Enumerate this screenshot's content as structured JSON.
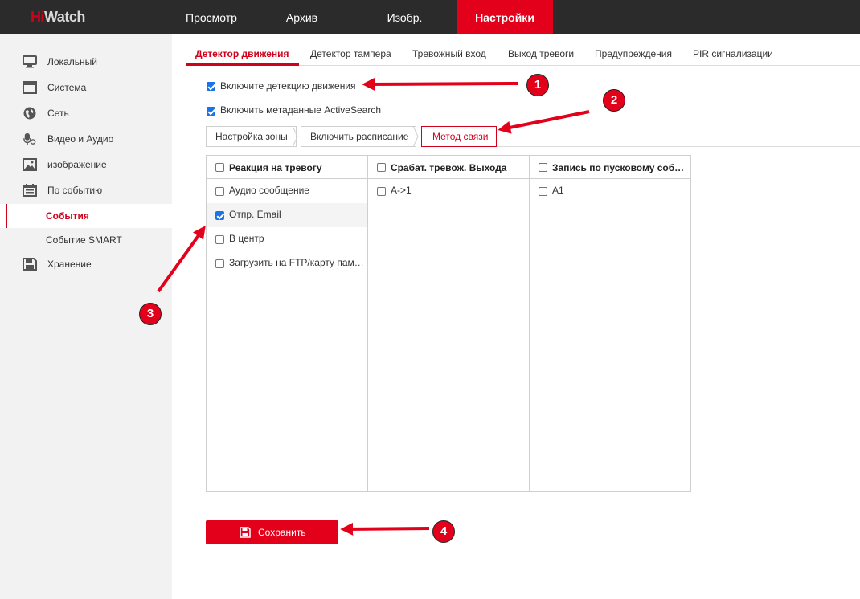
{
  "brand": {
    "hi": "Hi",
    "watch": "Watch"
  },
  "topnav": [
    {
      "label": "Просмотр",
      "active": false
    },
    {
      "label": "Архив",
      "active": false
    },
    {
      "label": "Изобр.",
      "active": false
    },
    {
      "label": "Настройки",
      "active": true
    }
  ],
  "sidebar": {
    "items": [
      {
        "label": "Локальный",
        "icon": "monitor-icon"
      },
      {
        "label": "Система",
        "icon": "window-icon"
      },
      {
        "label": "Сеть",
        "icon": "globe-icon"
      },
      {
        "label": "Видео и Аудио",
        "icon": "microphone-icon"
      },
      {
        "label": "изображение",
        "icon": "image-icon"
      },
      {
        "label": "По событию",
        "icon": "calendar-icon"
      }
    ],
    "sub_items": [
      {
        "label": "События",
        "active": true
      },
      {
        "label": "Событие SMART",
        "active": false
      }
    ],
    "storage": {
      "label": "Хранение",
      "icon": "floppy-icon"
    }
  },
  "tabs": [
    {
      "label": "Детектор движения",
      "active": true
    },
    {
      "label": "Детектор тампера",
      "active": false
    },
    {
      "label": "Тревожный вход",
      "active": false
    },
    {
      "label": "Выход тревоги",
      "active": false
    },
    {
      "label": "Предупреждения",
      "active": false
    },
    {
      "label": "PIR сигнализации",
      "active": false
    }
  ],
  "options": {
    "enable_motion": {
      "label": "Включите детекцию движения",
      "checked": true
    },
    "enable_metadata": {
      "label": "Включить метаданные ActiveSearch",
      "checked": true
    }
  },
  "subtabs": [
    {
      "label": "Настройка зоны",
      "active": false
    },
    {
      "label": "Включить расписание",
      "active": false
    },
    {
      "label": "Метод связи",
      "active": true
    }
  ],
  "linkage": {
    "columns": [
      {
        "header": "Реакция на тревогу",
        "checked": false,
        "rows": [
          {
            "label": "Аудио сообщение",
            "checked": false
          },
          {
            "label": "Отпр. Email",
            "checked": true
          },
          {
            "label": "В центр",
            "checked": false
          },
          {
            "label": "Загрузить на FTP/карту памяти",
            "checked": false
          }
        ]
      },
      {
        "header": "Срабат. тревож. Выхода",
        "checked": false,
        "rows": [
          {
            "label": "A->1",
            "checked": false
          }
        ]
      },
      {
        "header": "Запись по пусковому событию",
        "checked": false,
        "rows": [
          {
            "label": "A1",
            "checked": false
          }
        ]
      }
    ]
  },
  "save_label": "Сохранить",
  "annotations": [
    "1",
    "2",
    "3",
    "4"
  ],
  "colors": {
    "accent": "#e3001b",
    "topbar": "#2b2b2b",
    "sidebar": "#f2f2f2",
    "arrow": "#e3001b"
  }
}
